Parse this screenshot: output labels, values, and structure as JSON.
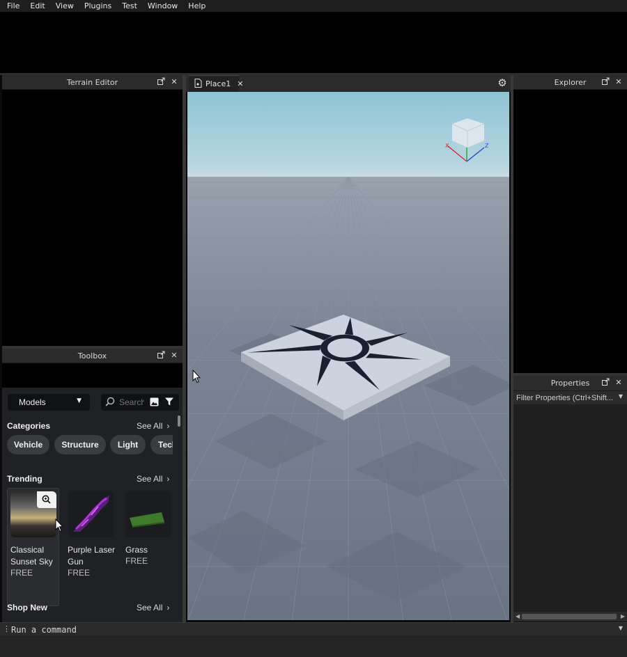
{
  "menu": [
    "File",
    "Edit",
    "View",
    "Plugins",
    "Test",
    "Window",
    "Help"
  ],
  "panels": {
    "terrain_editor": {
      "title": "Terrain Editor"
    },
    "toolbox": {
      "title": "Toolbox"
    },
    "explorer": {
      "title": "Explorer"
    },
    "properties": {
      "title": "Properties",
      "filter_placeholder": "Filter Properties (Ctrl+Shift..."
    }
  },
  "viewport": {
    "tab_label": "Place1"
  },
  "toolbox": {
    "dropdown_value": "Models",
    "search_placeholder": "Search",
    "categories_title": "Categories",
    "see_all": "See All",
    "categories": [
      "Vehicle",
      "Structure",
      "Light",
      "Tech"
    ],
    "trending_title": "Trending",
    "trending": [
      {
        "name": "Classical Sunset Sky",
        "price": "FREE"
      },
      {
        "name": "Purple Laser Gun",
        "price": "FREE"
      },
      {
        "name": "Grass",
        "price": "FREE"
      }
    ],
    "shop_new_title": "Shop New"
  },
  "command_bar": {
    "placeholder": "Run a command"
  },
  "colors": {
    "accent_bg": "#2b2b2b",
    "sky": "#9ccbd8",
    "ground": "#7b8494"
  }
}
